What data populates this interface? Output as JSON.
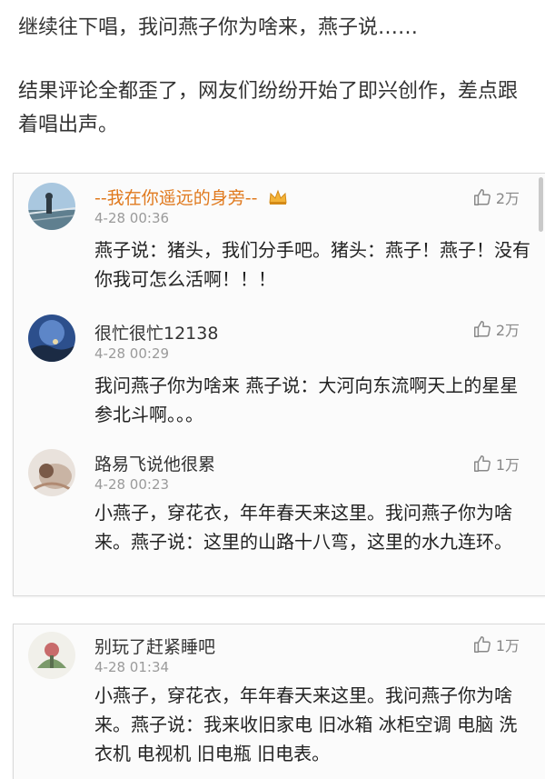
{
  "article": {
    "para1": "继续往下唱，我问燕子你为啥来，燕子说……",
    "para2": "结果评论全都歪了，网友们纷纷开始了即兴创作，差点跟着唱出声。"
  },
  "comments": [
    {
      "username": "--我在你遥远的身旁--",
      "timestamp": "4-28 00:36",
      "likes": "2万",
      "text": "燕子说：猪头，我们分手吧。猪头：燕子！燕子！没有你我可怎么活啊！！！"
    },
    {
      "username": "很忙很忙12138",
      "timestamp": "4-28 00:29",
      "likes": "2万",
      "text": "我问燕子你为啥来 燕子说：大河向东流啊天上的星星参北斗啊。。。"
    },
    {
      "username": "路易飞说他很累",
      "timestamp": "4-28 00:23",
      "likes": "1万",
      "text": "小燕子，穿花衣，年年春天来这里。我问燕子你为啥来。燕子说：这里的山路十八弯，这里的水九连环。"
    },
    {
      "username": "别玩了赶紧睡吧",
      "timestamp": "4-28 01:34",
      "likes": "1万",
      "text": "小燕子，穿花衣，年年春天来这里。我问燕子你为啥来。燕子说：我来收旧家电 旧冰箱 冰柜空调 电脑 洗衣机 电视机 旧电瓶 旧电表。"
    }
  ],
  "colors": {
    "username_gold": "#e0791d",
    "timestamp": "#9a9a9a",
    "card_border": "#d9d9d9"
  },
  "icons": {
    "like": "thumbs-up-icon",
    "vip": "crown-icon"
  }
}
